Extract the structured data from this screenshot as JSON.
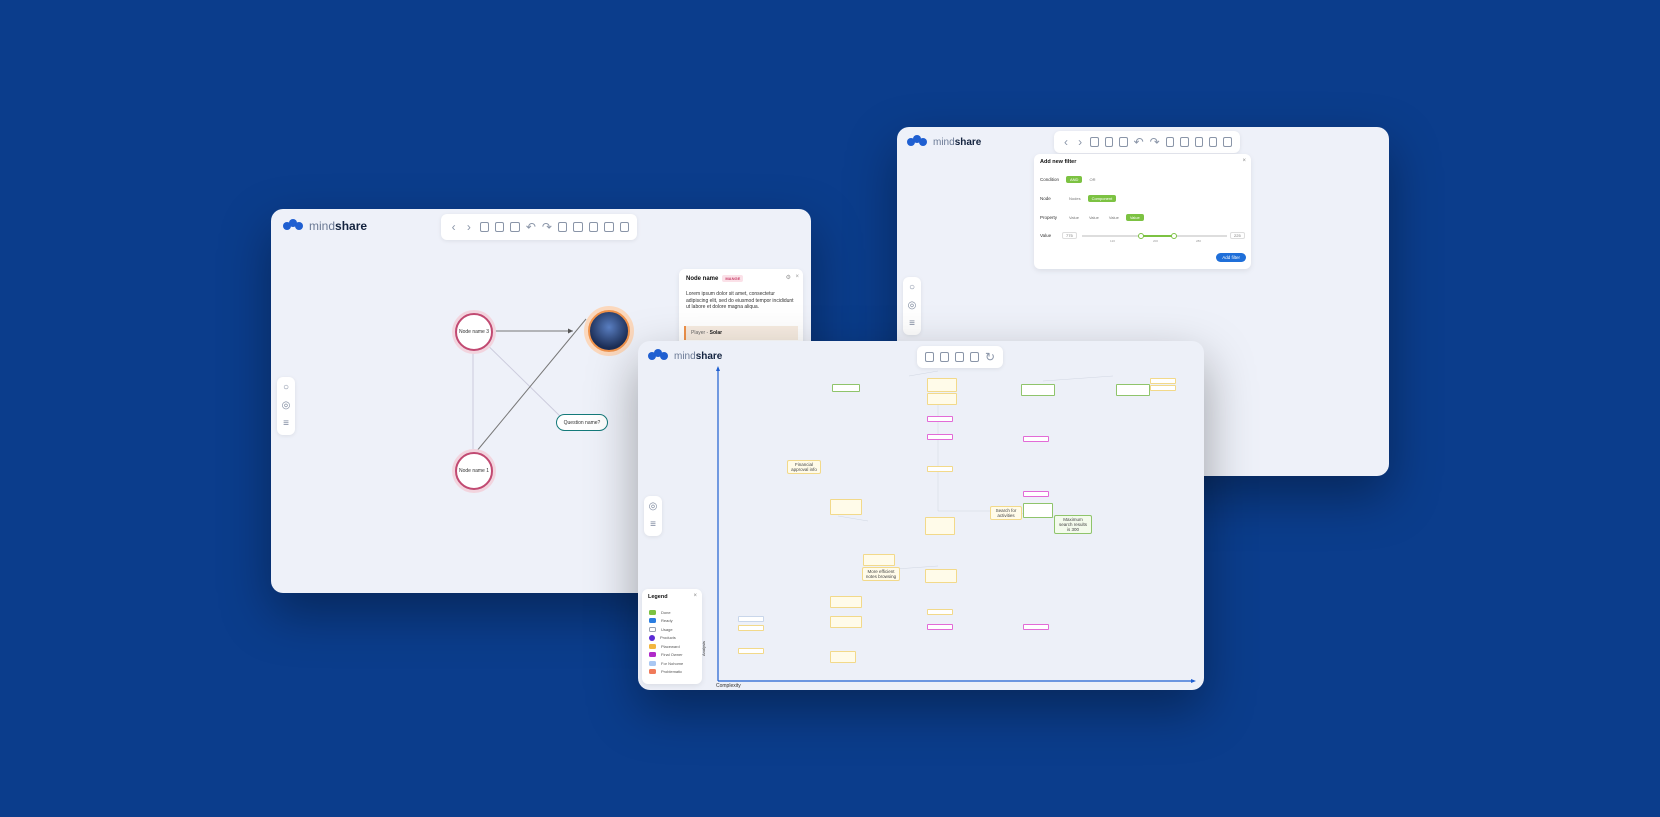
{
  "brand": {
    "name_light": "mind",
    "name_bold": "share"
  },
  "colors": {
    "background": "#0b3d8c",
    "accent": "#1f5fd1",
    "green": "#7cc242",
    "node_border": "#c14a72",
    "question_border": "#147a7a"
  },
  "graph_window": {
    "nodes": [
      {
        "label": "Node name 3"
      },
      {
        "label": "Node name 1"
      }
    ],
    "question_node": "Question name?",
    "detail_panel": {
      "title": "Node name",
      "tag": "MANGE",
      "body": "Lorem ipsum dolor sit amet, consectetur adipiscing elit, sed do eiusmod tempor incididunt ut labore et dolore magna aliqua.",
      "player_label": "Player -",
      "player_value": "Solar"
    }
  },
  "filter_window": {
    "dialog_title": "Add new filter",
    "condition_label": "Condition",
    "condition_options": [
      "AND",
      "OR"
    ],
    "node_label": "Node",
    "node_options": [
      "Nodes",
      "Component"
    ],
    "property_label": "Property",
    "property_options": [
      "Value",
      "Value",
      "Value",
      "Value"
    ],
    "value_label": "Value",
    "value_min": "775",
    "value_max": "225",
    "slider_ticks": [
      "120",
      "200",
      "280"
    ],
    "add_button": "Add filter"
  },
  "matrix_window": {
    "x_axis_label": "Complexity",
    "y_axis_label": "Analysis",
    "big_nodes": [
      "Financial approval info",
      "Search for activities",
      "More efficient notes browsing",
      "Maximum search results is 300"
    ],
    "legend": {
      "title": "Legend",
      "items": [
        {
          "label": "Done",
          "color": "#7cc242"
        },
        {
          "label": "Ready",
          "color": "#2a7de1"
        },
        {
          "label": "Usage",
          "color": "#9aa3b3"
        },
        {
          "label": "Products",
          "color": "#5b2bd6"
        },
        {
          "label": "Placeward",
          "color": "#f2b640"
        },
        {
          "label": "Final Owner",
          "color": "#b02ac9"
        },
        {
          "label": "For Nohome",
          "color": "#a9c7f2"
        },
        {
          "label": "Problematic",
          "color": "#f07a5a"
        }
      ]
    }
  }
}
